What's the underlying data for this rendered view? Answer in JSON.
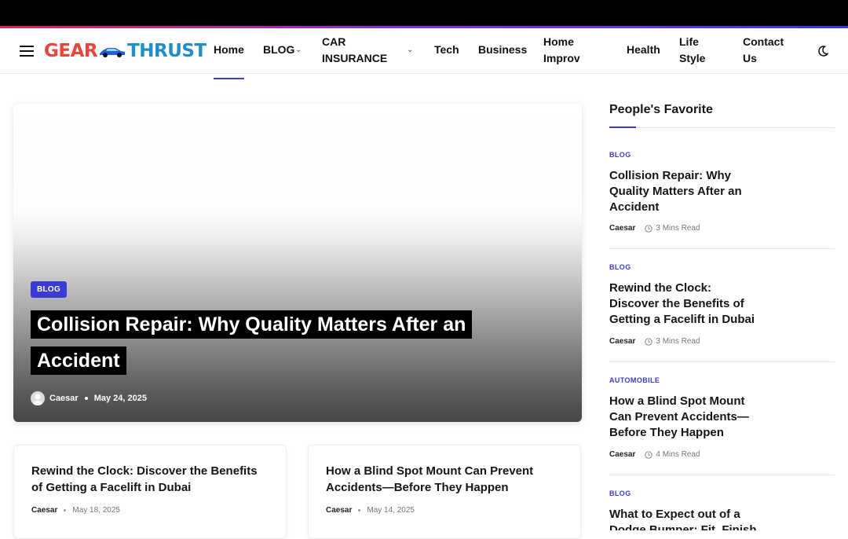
{
  "logo": {
    "part1": "GEAR",
    "part2": "THRUST"
  },
  "nav": {
    "home": "Home",
    "blog": "BLOG",
    "car_insurance_line1": "CAR",
    "car_insurance_line2": "INSURANCE",
    "tech": "Tech",
    "business": "Business",
    "home_improv_line1": "Home",
    "home_improv_line2": "Improv",
    "health": "Health",
    "life_style_line1": "Life",
    "life_style_line2": "Style",
    "contact_line1": "Contact",
    "contact_line2": "Us"
  },
  "hero": {
    "category": "BLOG",
    "title": "Collision Repair: Why Quality Matters After an Accident",
    "author": "Caesar",
    "date": "May 24, 2025"
  },
  "cards": [
    {
      "title": "Rewind the Clock: Discover the Benefits of Getting a Facelift in Dubai",
      "author": "Caesar",
      "date": "May 18, 2025"
    },
    {
      "title": "How a Blind Spot Mount Can Prevent Accidents—Before They Happen",
      "author": "Caesar",
      "date": "May 14, 2025"
    }
  ],
  "sidebar": {
    "title": "People's Favorite",
    "items": [
      {
        "category": "BLOG",
        "title": "Collision Repair: Why Quality Matters After an Accident",
        "author": "Caesar",
        "read": "3 Mins Read"
      },
      {
        "category": "BLOG",
        "title": "Rewind the Clock: Discover the Benefits of Getting a Facelift in Dubai",
        "author": "Caesar",
        "read": "3 Mins Read"
      },
      {
        "category": "AUTOMOBILE",
        "title": "How a Blind Spot Mount Can Prevent Accidents—Before They Happen",
        "author": "Caesar",
        "read": "4 Mins Read"
      },
      {
        "category": "BLOG",
        "title": "What to Expect out of a Dodge Bumper: Fit, Finish"
      }
    ]
  },
  "colors": {
    "accent": "#3b3bd6",
    "logo_red": "#e8463a",
    "logo_blue": "#1e8fc8"
  }
}
